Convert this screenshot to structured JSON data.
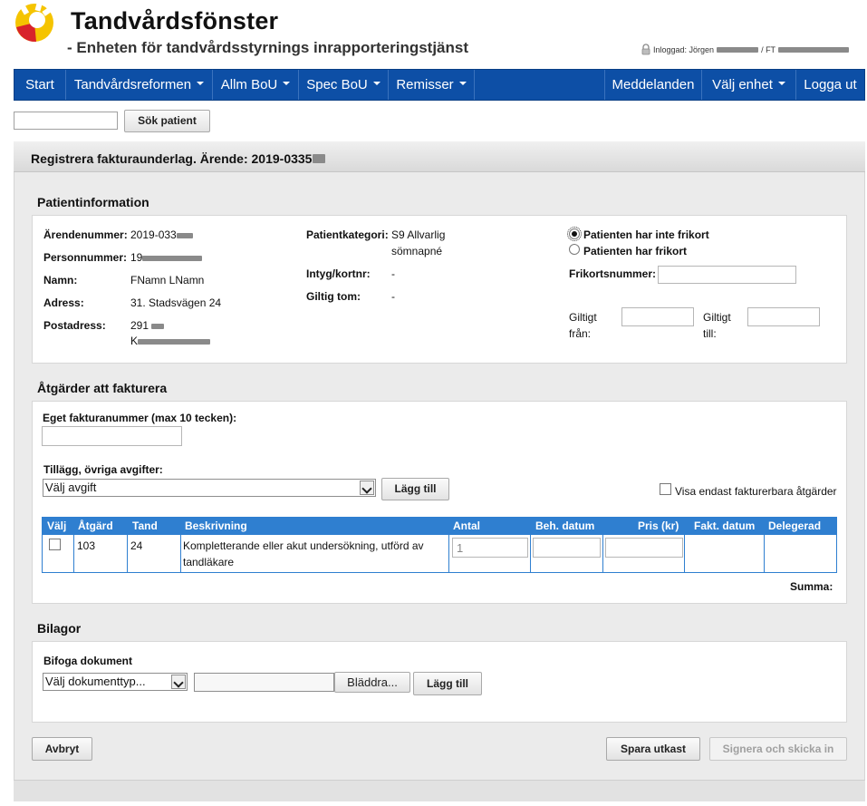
{
  "header": {
    "title": "Tandvårdsfönster",
    "subtitle": "- Enheten för tandvårdsstyrnings inrapporteringstjänst",
    "login_prefix": "Inloggad: Jörgen",
    "login_sep": "/ FT",
    "lock_icon": "lock-icon"
  },
  "nav": {
    "items": [
      {
        "label": "Start"
      },
      {
        "label": "Tandvårdsreformen"
      },
      {
        "label": "Allm BoU"
      },
      {
        "label": "Spec BoU"
      },
      {
        "label": "Remisser"
      }
    ],
    "right_items": [
      {
        "label": "Meddelanden"
      },
      {
        "label": "Välj enhet"
      },
      {
        "label": "Logga ut"
      }
    ],
    "bg_color": "#0d4fa6"
  },
  "search": {
    "value": "",
    "button_label": "Sök patient"
  },
  "page": {
    "title_prefix": "Registrera fakturaunderlag. Ärende: 2019-0335"
  },
  "patient": {
    "section_title": "Patientinformation",
    "arende_label": "Ärendenummer:",
    "arende_value": "2019-033",
    "person_label": "Personnummer:",
    "person_value": "19",
    "namn_label": "Namn:",
    "namn_value": "FNamn LNamn",
    "adress_label": "Adress:",
    "adress_value": "31. Stadsvägen 24",
    "postadress_label": "Postadress:",
    "postadress_value": "291",
    "postadress_line2": "K",
    "kategori_label": "Patientkategori:",
    "kategori_line1": "S9 Allvarlig",
    "kategori_line2": "sömnapné",
    "intyg_label": "Intyg/kortnr:",
    "intyg_value": "-",
    "giltig_label": "Giltig tom:",
    "giltig_value": "-",
    "radio_no_frikort": "Patienten har inte frikort",
    "radio_frikort": "Patienten har frikort",
    "frikortsnummer_label": "Frikortsnummer:",
    "giltigt_fran_line1": "Giltigt",
    "giltigt_fran_line2": "från:",
    "giltigt_till_line1": "Giltigt",
    "giltigt_till_line2": "till:"
  },
  "actions": {
    "section_title": "Åtgärder att fakturera",
    "eget_label": "Eget fakturanummer (max 10 tecken):",
    "eget_value": "",
    "tillagg_label": "Tillägg, övriga avgifter:",
    "avgift_selected": "Välj avgift",
    "add_button": "Lägg till",
    "visa_label": "Visa endast fakturerbara åtgärder",
    "columns": [
      "Välj",
      "Åtgärd",
      "Tand",
      "Beskrivning",
      "Antal",
      "Beh. datum",
      "Pris (kr)",
      "Fakt. datum",
      "Delegerad"
    ],
    "rows": [
      {
        "atgard": "103",
        "tand": "24",
        "beskrivning_line1": "Kompletterande eller akut undersökning, utförd av",
        "beskrivning_line2": "tandläkare",
        "antal": "1",
        "beh_datum": "",
        "pris": "",
        "fakt_datum": "",
        "delegerad": ""
      }
    ],
    "summa_label": "Summa:",
    "header_color": "#2f7fd0"
  },
  "bilagor": {
    "section_title": "Bilagor",
    "bifoga_label": "Bifoga dokument",
    "doctype_selected": "Välj dokumenttyp...",
    "browse_button": "Bläddra...",
    "add_button": "Lägg till"
  },
  "footer": {
    "cancel_button": "Avbryt",
    "save_button": "Spara utkast",
    "sign_button": "Signera och skicka in"
  }
}
